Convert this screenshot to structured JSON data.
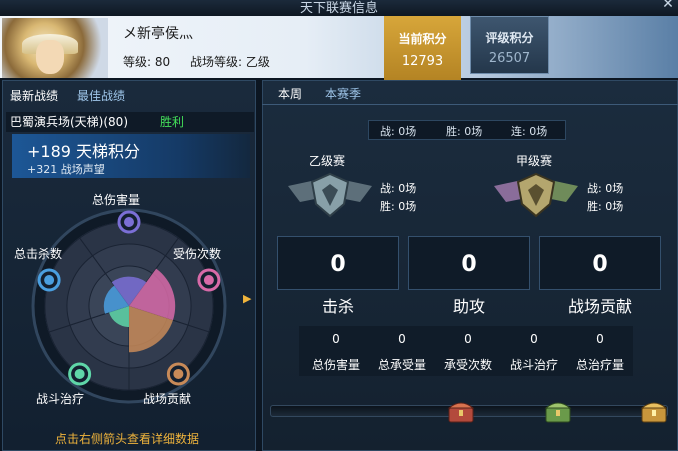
{
  "window": {
    "title": "天下联赛信息"
  },
  "player": {
    "name": "メ新亭侯灬",
    "level_label": "等级: 80",
    "battle_grade_label": "战场等级: 乙级"
  },
  "scores": {
    "current_label": "当前积分",
    "current_value": "12793",
    "rating_label": "评级积分",
    "rating_value": "26507"
  },
  "left_tabs": [
    "最新战绩",
    "最佳战绩"
  ],
  "latest": {
    "battle_name": "巴蜀演兵场(天梯)(80)",
    "result": "胜利",
    "ladder_points": "+189 天梯积分",
    "prestige": "+321 战场声望"
  },
  "radar": {
    "axes": [
      "总伤害量",
      "受伤次数",
      "战场贡献",
      "战斗治疗",
      "总击杀数"
    ],
    "colors": [
      "#7b6fd6",
      "#d86aa8",
      "#c88a58",
      "#5fd6a8",
      "#4a9fe0"
    ]
  },
  "hint": "点击右侧箭头查看详细数据",
  "right_tabs": [
    "本周",
    "本赛季"
  ],
  "week_summary": {
    "battles": "战: 0场",
    "wins": "胜: 0场",
    "streak": "连: 0场"
  },
  "grades": [
    {
      "name": "乙级赛",
      "battles": "战: 0场",
      "wins": "胜: 0场"
    },
    {
      "name": "甲级赛",
      "battles": "战: 0场",
      "wins": "胜: 0场"
    }
  ],
  "big_stats": [
    {
      "label": "击杀",
      "value": "0"
    },
    {
      "label": "助攻",
      "value": "0"
    },
    {
      "label": "战场贡献",
      "value": "0"
    }
  ],
  "small_stats": [
    {
      "label": "总伤害量",
      "value": "0"
    },
    {
      "label": "总承受量",
      "value": "0"
    },
    {
      "label": "承受次数",
      "value": "0"
    },
    {
      "label": "战斗治疗",
      "value": "0"
    },
    {
      "label": "总治疗量",
      "value": "0"
    }
  ],
  "progress": {
    "value": 0
  }
}
